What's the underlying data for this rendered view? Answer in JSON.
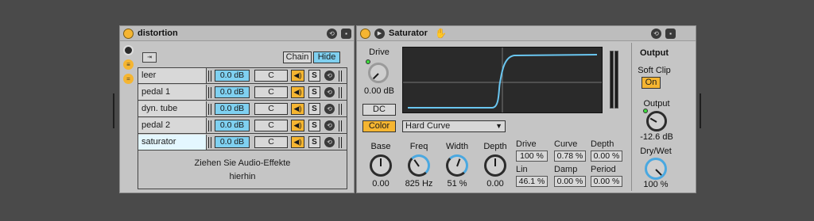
{
  "rack": {
    "title": "distortion",
    "chain_label": "Chain",
    "hide_label": "Hide",
    "drop_hint_line1": "Ziehen Sie Audio-Effekte",
    "drop_hint_line2": "hierhin",
    "chains": [
      {
        "name": "leer",
        "volume": "0.0 dB",
        "pan": "C",
        "solo": "S",
        "selected": false
      },
      {
        "name": "pedal 1",
        "volume": "0.0 dB",
        "pan": "C",
        "solo": "S",
        "selected": false
      },
      {
        "name": "dyn. tube",
        "volume": "0.0 dB",
        "pan": "C",
        "solo": "S",
        "selected": false
      },
      {
        "name": "pedal 2",
        "volume": "0.0 dB",
        "pan": "C",
        "solo": "S",
        "selected": false
      },
      {
        "name": "saturator",
        "volume": "0.0 dB",
        "pan": "C",
        "solo": "S",
        "selected": true
      }
    ]
  },
  "saturator": {
    "title": "Saturator",
    "drive_label": "Drive",
    "drive_value": "0.00 dB",
    "dc_label": "DC",
    "color_label": "Color",
    "curve_type": "Hard Curve",
    "output_section": "Output",
    "soft_clip_label": "Soft Clip",
    "soft_clip_value": "On",
    "output_label": "Output",
    "output_value": "-12.6 dB",
    "drywet_label": "Dry/Wet",
    "drywet_value": "100 %",
    "color_knobs": [
      {
        "label": "Base",
        "value": "0.00"
      },
      {
        "label": "Freq",
        "value": "825 Hz"
      },
      {
        "label": "Width",
        "value": "51 %"
      },
      {
        "label": "Depth",
        "value": "0.00"
      }
    ],
    "waveshaper": [
      {
        "label": "Drive",
        "value": "100 %"
      },
      {
        "label": "Curve",
        "value": "0.78 %"
      },
      {
        "label": "Depth",
        "value": "0.00 %"
      },
      {
        "label": "Lin",
        "value": "46.1 %"
      },
      {
        "label": "Damp",
        "value": "0.00 %"
      },
      {
        "label": "Period",
        "value": "0.00 %"
      }
    ]
  },
  "colors": {
    "background": "#4a4a4a",
    "panel": "#c5c5c5",
    "accent_orange": "#f5b531",
    "accent_blue": "#7fd0f0",
    "curve": "#6ac6f0"
  }
}
